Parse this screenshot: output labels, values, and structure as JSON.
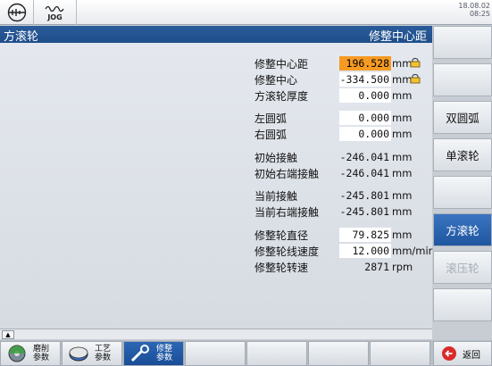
{
  "header": {
    "jog_label": "JOG",
    "clock_line1": "18.08.02",
    "clock_line2": "08:25"
  },
  "title": {
    "left": "方滚轮",
    "right": "修整中心距"
  },
  "params": [
    {
      "label": "修整中心距",
      "value": "196.528",
      "unit": "mm",
      "style": "sel",
      "lock": true
    },
    {
      "label": "修整中心",
      "value": "-334.500",
      "unit": "mm",
      "style": "box",
      "lock": true
    },
    {
      "label": "方滚轮厚度",
      "value": "0.000",
      "unit": "mm",
      "style": "box",
      "lock": false
    },
    {
      "label": "左圆弧",
      "value": "0.000",
      "unit": "mm",
      "style": "box",
      "lock": false
    },
    {
      "label": "右圆弧",
      "value": "0.000",
      "unit": "mm",
      "style": "box",
      "lock": false
    },
    {
      "label": "初始接触",
      "value": "-246.041",
      "unit": "mm",
      "style": "plain",
      "lock": false
    },
    {
      "label": "初始右端接触",
      "value": "-246.041",
      "unit": "mm",
      "style": "plain",
      "lock": false
    },
    {
      "label": "当前接触",
      "value": "-245.801",
      "unit": "mm",
      "style": "plain",
      "lock": false
    },
    {
      "label": "当前右端接触",
      "value": "-245.801",
      "unit": "mm",
      "style": "plain",
      "lock": false
    },
    {
      "label": "修整轮直径",
      "value": "79.825",
      "unit": "mm",
      "style": "box",
      "lock": false
    },
    {
      "label": "修整轮线速度",
      "value": "12.000",
      "unit": "mm/mir",
      "style": "box",
      "lock": false
    },
    {
      "label": "修整轮转速",
      "value": "2871",
      "unit": "rpm",
      "style": "plain",
      "lock": false
    }
  ],
  "softkeys": [
    {
      "label": "",
      "state": "normal"
    },
    {
      "label": "",
      "state": "normal"
    },
    {
      "label": "双圆弧",
      "state": "normal"
    },
    {
      "label": "单滚轮",
      "state": "normal"
    },
    {
      "label": "",
      "state": "normal"
    },
    {
      "label": "方滚轮",
      "state": "active"
    },
    {
      "label": "滚压轮",
      "state": "disabled"
    },
    {
      "label": "",
      "state": "normal"
    }
  ],
  "hkeys": [
    {
      "label1": "磨削",
      "label2": "参数",
      "icon": "grinding-wheel-icon",
      "active": false
    },
    {
      "label1": "工艺",
      "label2": "参数",
      "icon": "process-icon",
      "active": false
    },
    {
      "label1": "修整",
      "label2": "参数",
      "icon": "dressing-tool-icon",
      "active": true
    }
  ],
  "back_label": "返回",
  "colors": {
    "accent": "#1f56a0",
    "selected": "#f59a23"
  }
}
